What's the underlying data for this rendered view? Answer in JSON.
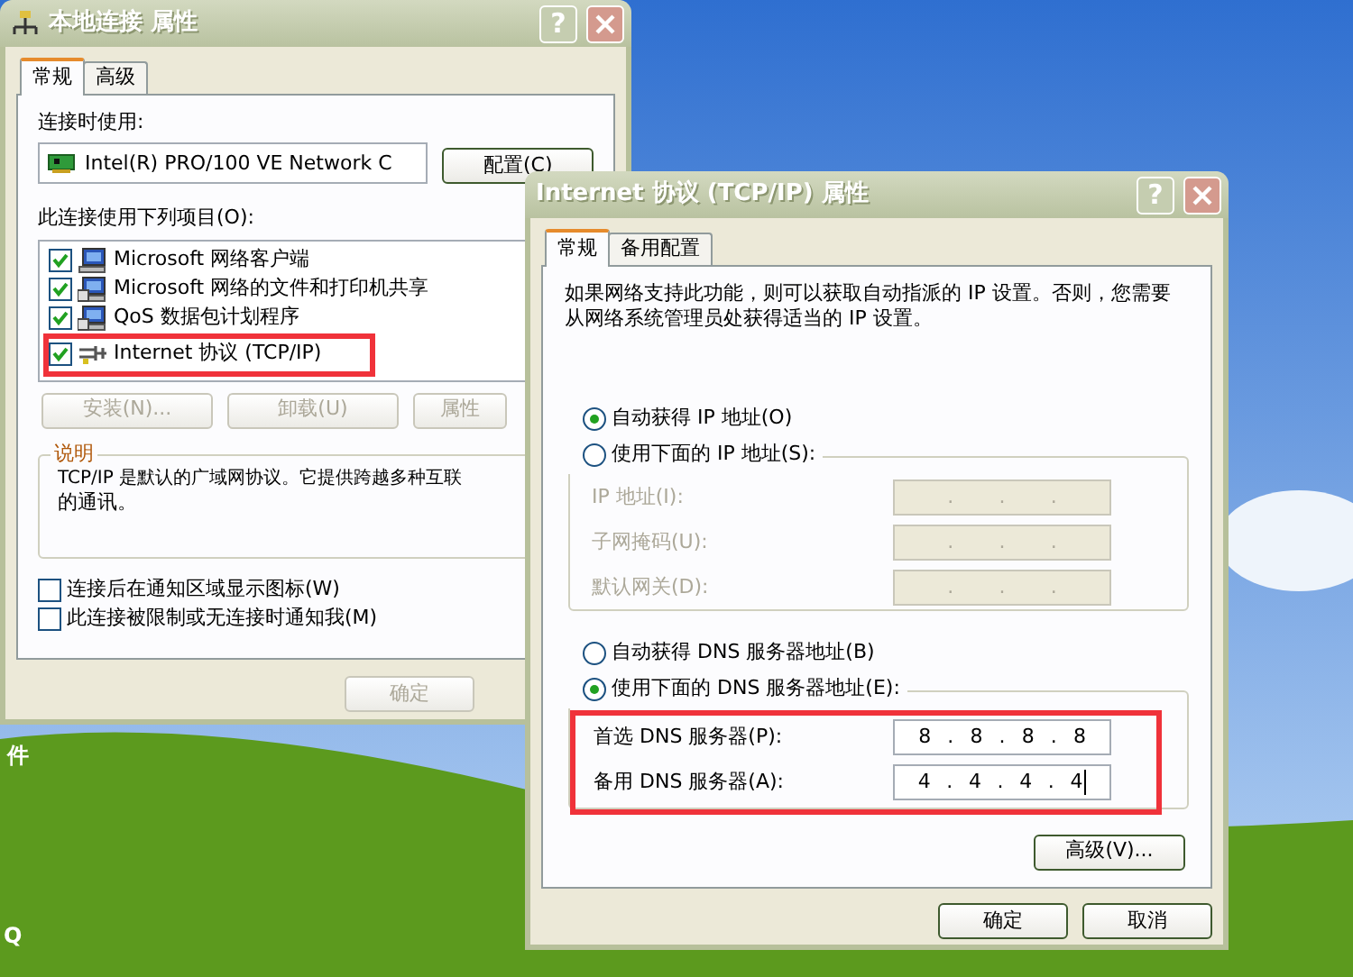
{
  "desktop": {
    "labels": [
      "件",
      "Q"
    ]
  },
  "connection_properties": {
    "title": "本地连接 属性",
    "help_button": "?",
    "tabs": [
      {
        "label": "常规",
        "selected": true
      },
      {
        "label": "高级",
        "selected": false
      }
    ],
    "connect_using_label": "连接时使用:",
    "adapter": "Intel(R) PRO/100 VE Network C",
    "configure_button": "配置(C)",
    "components_label": "此连接使用下列项目(O):",
    "components": [
      {
        "label": "Microsoft 网络客户端",
        "kind": "client",
        "checked": true,
        "highlighted": false
      },
      {
        "label": "Microsoft 网络的文件和打印机共享",
        "kind": "service",
        "checked": true,
        "highlighted": false
      },
      {
        "label": "QoS 数据包计划程序",
        "kind": "service",
        "checked": true,
        "highlighted": false
      },
      {
        "label": "Internet 协议 (TCP/IP)",
        "kind": "protocol",
        "checked": true,
        "highlighted": true
      }
    ],
    "component_buttons": [
      {
        "label": "安装(N)...",
        "disabled": true
      },
      {
        "label": "卸载(U)",
        "disabled": true
      },
      {
        "label": "属性",
        "disabled": true
      }
    ],
    "description": {
      "title": "说明",
      "lines": [
        "TCP/IP 是默认的广域网协议。它提供跨越多种互联",
        "的通讯。"
      ]
    },
    "options": [
      {
        "label": "连接后在通知区域显示图标(W)",
        "checked": false
      },
      {
        "label": "此连接被限制或无连接时通知我(M)",
        "checked": false
      }
    ],
    "buttons": [
      {
        "label": "确定",
        "disabled": true
      }
    ]
  },
  "tcpip_properties": {
    "title": "Internet 协议 (TCP/IP) 属性",
    "help_button": "?",
    "tabs": [
      {
        "label": "常规",
        "selected": true
      },
      {
        "label": "备用配置",
        "selected": false
      }
    ],
    "intro": "如果网络支持此功能，则可以获取自动指派的 IP 设置。否则，您需要从网络系统管理员处获得适当的 IP 设置。",
    "ip_modes": [
      {
        "label": "自动获得 IP 地址(O)",
        "selected": true
      },
      {
        "label": "使用下面的 IP 地址(S):",
        "selected": false
      }
    ],
    "ip_fields": [
      {
        "label": "IP 地址(I):",
        "value": ". . .",
        "disabled": true,
        "focused": false
      },
      {
        "label": "子网掩码(U):",
        "value": ". . .",
        "disabled": true,
        "focused": false
      },
      {
        "label": "默认网关(D):",
        "value": ". . .",
        "disabled": true,
        "focused": false
      }
    ],
    "dns_modes": [
      {
        "label": "自动获得 DNS 服务器地址(B)",
        "selected": false
      },
      {
        "label": "使用下面的 DNS 服务器地址(E):",
        "selected": true
      }
    ],
    "dns_highlighted": true,
    "dns_fields": [
      {
        "label": "首选 DNS 服务器(P):",
        "value": "8 . 8 . 8 . 8",
        "disabled": false
      },
      {
        "label": "备用 DNS 服务器(A):",
        "value": "4 . 4 . 4 . 4",
        "disabled": false,
        "focused": true
      }
    ],
    "advanced_button": "高级(V)...",
    "buttons": [
      {
        "label": "确定",
        "disabled": false
      },
      {
        "label": "取消",
        "disabled": false
      }
    ]
  }
}
